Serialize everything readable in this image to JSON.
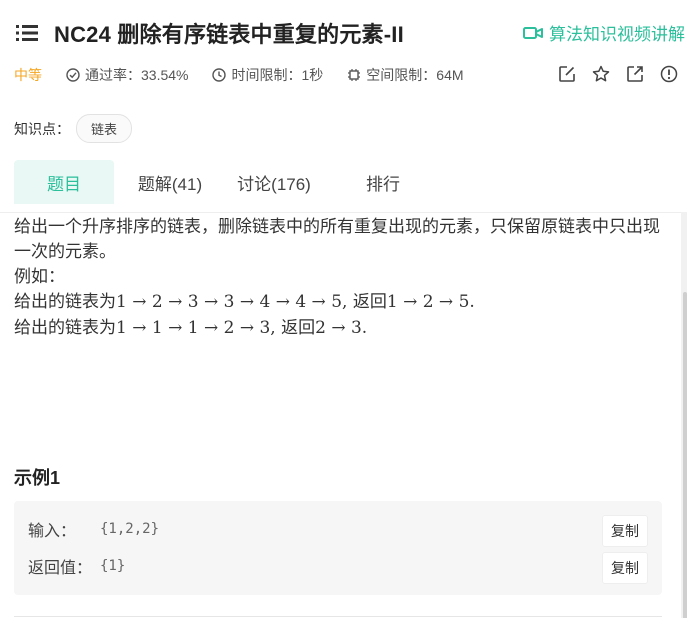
{
  "header": {
    "title": "NC24  删除有序链表中重复的元素-II",
    "video_link": "算法知识视频讲解",
    "accent_color": "#2bbf9b"
  },
  "meta": {
    "difficulty": "中等",
    "pass_rate": "通过率：33.54%",
    "time_limit": "时间限制：1秒",
    "space_limit": "空间限制：64M"
  },
  "actions": [
    "edit-icon",
    "star-icon",
    "share-icon",
    "info-icon"
  ],
  "knowledge": {
    "label": "知识点：",
    "tag": "链表"
  },
  "tabs": [
    {
      "label": "题目",
      "active": true
    },
    {
      "label": "题解(41)",
      "active": false
    },
    {
      "label": "讨论(176)",
      "active": false
    },
    {
      "label": "排行",
      "active": false
    }
  ],
  "description": {
    "line1": "给出一个升序排序的链表，删除链表中的所有重复出现的元素，只保留原链表中只出现一次的元素。",
    "line2": "例如：",
    "ex1_prefix": "给出的链表为",
    "ex1_list": "1 → 2 → 3 → 3 → 4 → 4 → 5",
    "ex1_mid": ", 返回",
    "ex1_result": "1 → 2 → 5.",
    "ex2_prefix": "给出的链表为",
    "ex2_list": "1 → 1 → 1 → 2 → 3",
    "ex2_mid": ", 返回",
    "ex2_result": "2 → 3."
  },
  "example": {
    "title": "示例1",
    "input_label": "输入：",
    "input_value": "{1,2,2}",
    "output_label": "返回值：",
    "output_value": "{1}",
    "copy_label": "复制"
  }
}
